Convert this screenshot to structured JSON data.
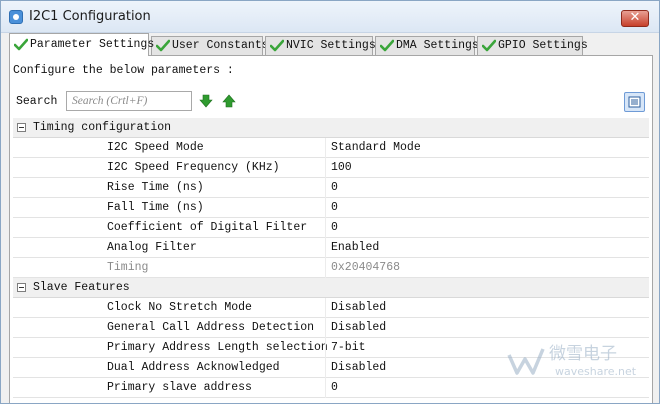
{
  "window": {
    "title": "I2C1 Configuration",
    "close_symbol": "✕"
  },
  "tabs": [
    {
      "label": "Parameter Settings",
      "active": true
    },
    {
      "label": "User Constants",
      "active": false
    },
    {
      "label": "NVIC Settings",
      "active": false
    },
    {
      "label": "DMA Settings",
      "active": false
    },
    {
      "label": "GPIO Settings",
      "active": false
    }
  ],
  "panel": {
    "configure_label": "Configure the below parameters :",
    "search_label": "Search :",
    "search_placeholder": "Search (Crtl+F)"
  },
  "groups": [
    {
      "label": "Timing configuration",
      "params": [
        {
          "name": "I2C Speed Mode",
          "value": "Standard Mode"
        },
        {
          "name": "I2C Speed Frequency (KHz)",
          "value": "100"
        },
        {
          "name": "Rise Time (ns)",
          "value": "0"
        },
        {
          "name": "Fall Time (ns)",
          "value": "0"
        },
        {
          "name": "Coefficient of Digital Filter",
          "value": "0"
        },
        {
          "name": "Analog Filter",
          "value": "Enabled"
        },
        {
          "name": "Timing",
          "value": "0x20404768",
          "readonly": true
        }
      ]
    },
    {
      "label": "Slave Features",
      "params": [
        {
          "name": "Clock No Stretch Mode",
          "value": "Disabled"
        },
        {
          "name": "General Call Address Detection",
          "value": "Disabled"
        },
        {
          "name": "Primary Address Length selection",
          "value": "7-bit"
        },
        {
          "name": "Dual Address Acknowledged",
          "value": "Disabled"
        },
        {
          "name": "Primary slave address",
          "value": "0"
        }
      ]
    }
  ],
  "watermark": {
    "line1": "微雪电子",
    "line2": "waveshare.net"
  },
  "colors": {
    "check_green": "#3aa53a",
    "arrow_green": "#2f9b2f",
    "title_bg": "#dce7f4"
  },
  "icons": [
    "check-icon",
    "arrow-down-icon",
    "arrow-up-icon",
    "list-view-icon",
    "collapse-icon"
  ]
}
